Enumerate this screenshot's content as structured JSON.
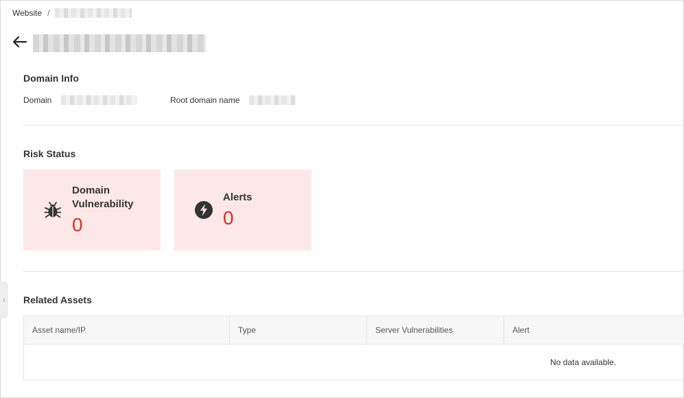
{
  "breadcrumb": {
    "root": "Website",
    "separator": "/"
  },
  "domain_info": {
    "title": "Domain Info",
    "domain_label": "Domain",
    "root_domain_label": "Root domain name"
  },
  "risk_status": {
    "title": "Risk Status",
    "cards": [
      {
        "label_line1": "Domain",
        "label_line2": "Vulnerability",
        "count": "0",
        "icon": "bug-icon"
      },
      {
        "label": "Alerts",
        "count": "0",
        "icon": "lightning-icon"
      }
    ],
    "card_bg": "#fde8e8",
    "count_color": "#d93026"
  },
  "related_assets": {
    "title": "Related Assets",
    "columns": [
      "Asset name/IP",
      "Type",
      "Server Vulnerabilities",
      "Alert"
    ],
    "empty_text": "No data available."
  }
}
